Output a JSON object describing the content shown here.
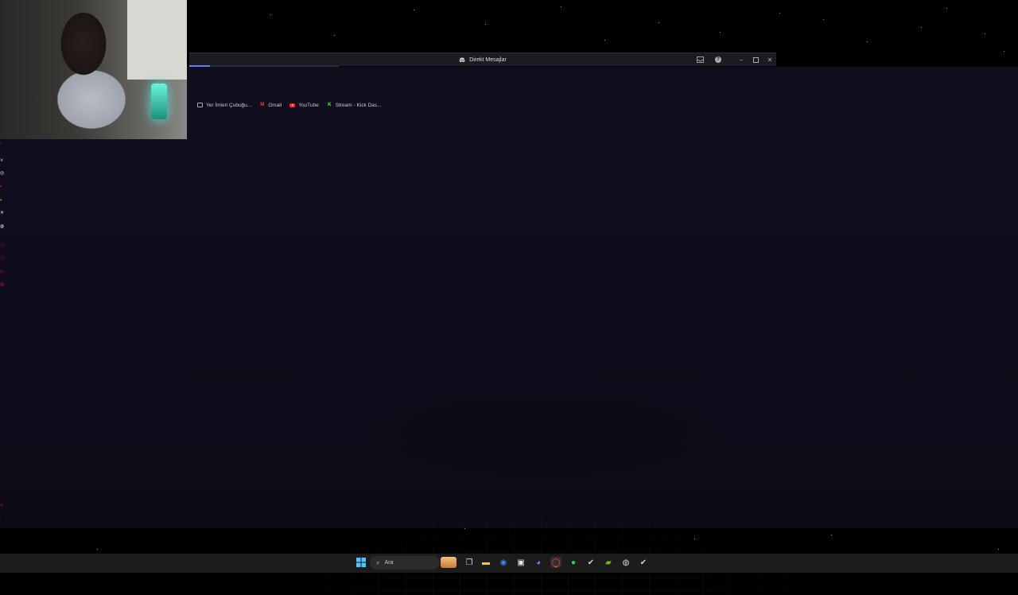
{
  "window": {
    "title": "Direkt Mesajlar"
  },
  "bookmarks": [
    {
      "label": "Yer İmleri Çubuğu...",
      "icon": "folder-icon"
    },
    {
      "label": "Gmail",
      "icon": "gmail-icon"
    },
    {
      "label": "YouTube",
      "icon": "youtube-icon"
    },
    {
      "label": "Stream - Kick Das...",
      "icon": "kick-icon"
    }
  ],
  "taskbar": {
    "search_placeholder": "Ara"
  },
  "page_load_progress": 0.14,
  "colors": {
    "app_background": "#100e1c",
    "accent_progress": "#6c7bff",
    "grid": "#7a3cc8",
    "taskbar": "#1c1c1c"
  }
}
